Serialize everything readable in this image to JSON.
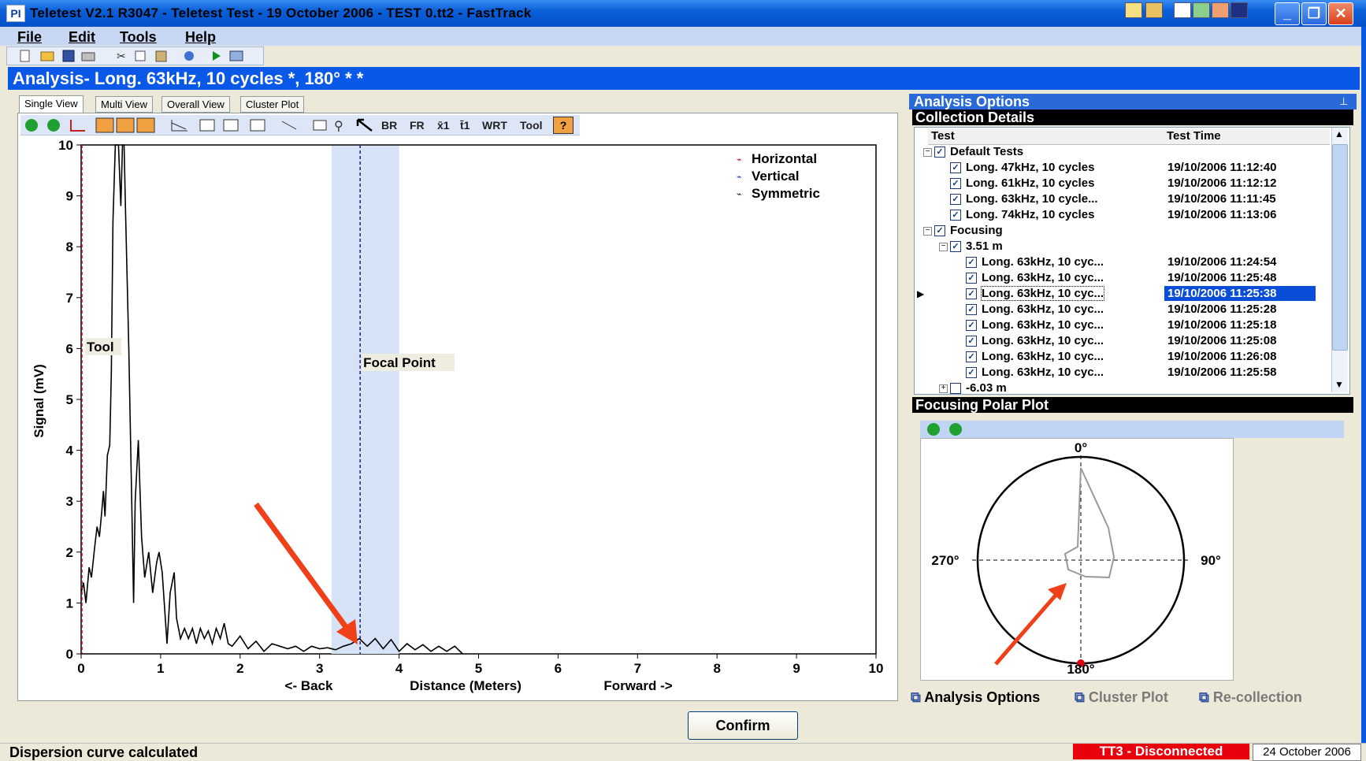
{
  "window": {
    "title": "Teletest V2.1 R3047 - Teletest Test - 19 October 2006 - TEST 0.tt2 - FastTrack",
    "app_icon": "PI"
  },
  "menu": [
    {
      "label": "File"
    },
    {
      "label": "Edit"
    },
    {
      "label": "Tools"
    },
    {
      "label": "Help"
    }
  ],
  "header": {
    "title": "Analysis- Long. 63kHz, 10 cycles  *, 180° * *"
  },
  "view_tabs": [
    {
      "label": "Single View"
    },
    {
      "label": "Multi View"
    },
    {
      "label": "Overall View"
    },
    {
      "label": "Cluster Plot"
    }
  ],
  "chart_toolbar": {
    "br": "BR",
    "fr": "FR",
    "x1": "x̄1",
    "t1": "t̄1",
    "wrt": "WRT",
    "tool": "Tool"
  },
  "chart_data": {
    "type": "line",
    "xlabel": "Distance (Meters)",
    "xlabel_left": "<- Back",
    "xlabel_right": "Forward ->",
    "ylabel": "Signal (mV)",
    "xlim": [
      0,
      10
    ],
    "ylim": [
      0,
      10
    ],
    "x_ticks": [
      "0",
      "1",
      "2",
      "3",
      "4",
      "5",
      "6",
      "7",
      "8",
      "9",
      "10"
    ],
    "y_ticks": [
      "0",
      "1",
      "2",
      "3",
      "4",
      "5",
      "6",
      "7",
      "8",
      "9",
      "10"
    ],
    "legend": [
      "Horizontal",
      "Vertical",
      "Symmetric"
    ],
    "legend_position": "top-right",
    "markers": [
      {
        "label": "Tool",
        "x": 0.0
      },
      {
        "label": "Focal Point",
        "x": 3.51
      }
    ],
    "gate": [
      3.15,
      4.0
    ],
    "series": [
      {
        "name": "Symmetric",
        "points": [
          [
            0,
            1.2
          ],
          [
            0.03,
            1.4
          ],
          [
            0.06,
            1.0
          ],
          [
            0.1,
            1.7
          ],
          [
            0.13,
            1.5
          ],
          [
            0.17,
            2.1
          ],
          [
            0.2,
            2.5
          ],
          [
            0.23,
            2.3
          ],
          [
            0.26,
            2.8
          ],
          [
            0.28,
            3.2
          ],
          [
            0.3,
            2.7
          ],
          [
            0.33,
            3.9
          ],
          [
            0.36,
            4.1
          ],
          [
            0.38,
            5.5
          ],
          [
            0.4,
            8.5
          ],
          [
            0.43,
            10
          ],
          [
            0.47,
            10
          ],
          [
            0.5,
            8.8
          ],
          [
            0.52,
            10
          ],
          [
            0.54,
            10
          ],
          [
            0.56,
            8.6
          ],
          [
            0.6,
            6.0
          ],
          [
            0.63,
            3.5
          ],
          [
            0.66,
            1.0
          ],
          [
            0.68,
            3.0
          ],
          [
            0.72,
            4.2
          ],
          [
            0.76,
            2.3
          ],
          [
            0.8,
            1.5
          ],
          [
            0.85,
            2.0
          ],
          [
            0.9,
            1.2
          ],
          [
            0.95,
            1.8
          ],
          [
            0.98,
            2.0
          ],
          [
            1.02,
            1.6
          ],
          [
            1.08,
            0.2
          ],
          [
            1.12,
            1.2
          ],
          [
            1.17,
            1.6
          ],
          [
            1.2,
            0.7
          ],
          [
            1.25,
            0.3
          ],
          [
            1.3,
            0.5
          ],
          [
            1.35,
            0.3
          ],
          [
            1.4,
            0.5
          ],
          [
            1.45,
            0.2
          ],
          [
            1.5,
            0.5
          ],
          [
            1.55,
            0.3
          ],
          [
            1.6,
            0.45
          ],
          [
            1.65,
            0.2
          ],
          [
            1.7,
            0.5
          ],
          [
            1.75,
            0.3
          ],
          [
            1.8,
            0.6
          ],
          [
            1.85,
            0.2
          ],
          [
            1.9,
            0.15
          ],
          [
            2.0,
            0.35
          ],
          [
            2.1,
            0.1
          ],
          [
            2.2,
            0.25
          ],
          [
            2.3,
            0.05
          ],
          [
            2.4,
            0.2
          ],
          [
            2.5,
            0.15
          ],
          [
            2.6,
            0.1
          ],
          [
            2.7,
            0.15
          ],
          [
            2.8,
            0.05
          ],
          [
            2.9,
            0.15
          ],
          [
            3.0,
            0.1
          ],
          [
            3.1,
            0.12
          ],
          [
            3.2,
            0.08
          ],
          [
            3.3,
            0.15
          ],
          [
            3.4,
            0.2
          ],
          [
            3.5,
            0.3
          ],
          [
            3.6,
            0.15
          ],
          [
            3.7,
            0.3
          ],
          [
            3.8,
            0.1
          ],
          [
            3.9,
            0.28
          ],
          [
            4.0,
            0.05
          ],
          [
            4.1,
            0.2
          ],
          [
            4.2,
            0.08
          ],
          [
            4.3,
            0.18
          ],
          [
            4.4,
            0.05
          ],
          [
            4.5,
            0.15
          ],
          [
            4.6,
            0.05
          ],
          [
            4.7,
            0.15
          ],
          [
            4.8,
            0.0
          ]
        ]
      }
    ]
  },
  "right_panel": {
    "title": "Analysis Options",
    "collection_title": "Collection Details",
    "columns": [
      "Test",
      "Test Time"
    ],
    "tree": [
      {
        "level": 0,
        "expander": "−",
        "checked": true,
        "label": "Default Tests",
        "time": ""
      },
      {
        "level": 1,
        "checked": true,
        "label": "Long. 47kHz, 10 cycles",
        "time": "19/10/2006 11:12:40"
      },
      {
        "level": 1,
        "checked": true,
        "label": "Long. 61kHz, 10 cycles",
        "time": "19/10/2006 11:12:12"
      },
      {
        "level": 1,
        "checked": true,
        "label": "Long. 63kHz, 10 cycle...",
        "time": "19/10/2006 11:11:45"
      },
      {
        "level": 1,
        "checked": true,
        "label": "Long. 74kHz, 10 cycles",
        "time": "19/10/2006 11:13:06"
      },
      {
        "level": 0,
        "expander": "−",
        "checked": true,
        "label": "Focusing",
        "time": ""
      },
      {
        "level": 1,
        "expander": "−",
        "checked": true,
        "label": "3.51 m",
        "time": ""
      },
      {
        "level": 2,
        "checked": true,
        "label": "Long. 63kHz, 10 cyc...",
        "time": "19/10/2006 11:24:54"
      },
      {
        "level": 2,
        "checked": true,
        "label": "Long. 63kHz, 10 cyc...",
        "time": "19/10/2006 11:25:48"
      },
      {
        "level": 2,
        "checked": true,
        "label": "Long. 63kHz, 10 cyc...",
        "time": "19/10/2006 11:25:38",
        "selected": true
      },
      {
        "level": 2,
        "checked": true,
        "label": "Long. 63kHz, 10 cyc...",
        "time": "19/10/2006 11:25:28"
      },
      {
        "level": 2,
        "checked": true,
        "label": "Long. 63kHz, 10 cyc...",
        "time": "19/10/2006 11:25:18"
      },
      {
        "level": 2,
        "checked": true,
        "label": "Long. 63kHz, 10 cyc...",
        "time": "19/10/2006 11:25:08"
      },
      {
        "level": 2,
        "checked": true,
        "label": "Long. 63kHz, 10 cyc...",
        "time": "19/10/2006 11:26:08"
      },
      {
        "level": 2,
        "checked": true,
        "label": "Long. 63kHz, 10 cyc...",
        "time": "19/10/2006 11:25:58"
      },
      {
        "level": 1,
        "expander": "+",
        "checked": false,
        "label": "-6.03 m",
        "time": ""
      }
    ],
    "polar_title": "Focusing Polar Plot",
    "polar_labels": {
      "top": "0°",
      "right": "90°",
      "bottom": "180°",
      "left": "270°"
    },
    "bottom_tabs": [
      {
        "label": "Analysis Options"
      },
      {
        "label": "Cluster Plot"
      },
      {
        "label": "Re-collection"
      }
    ]
  },
  "confirm_label": "Confirm",
  "status": {
    "message": "Dispersion curve calculated",
    "connection": "TT3 - Disconnected",
    "date": "24 October 2006"
  },
  "colors": {
    "title_bar": "#0a5fd8",
    "header": "#0a58e8",
    "selection": "#0a4ed8",
    "disconnected": "#e8000c",
    "annotation_arrow": "#f0401a"
  }
}
